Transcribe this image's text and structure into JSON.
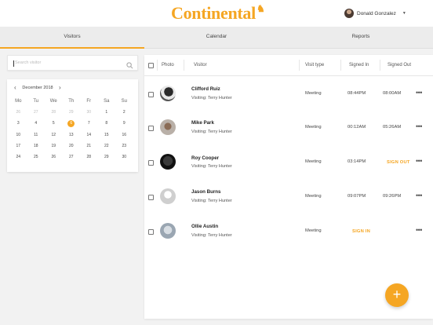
{
  "brand": {
    "logo_text": "Continental",
    "accent": "#f5a623"
  },
  "user": {
    "name": "Donald Gonzalez",
    "caret_icon": "chevron-down-icon"
  },
  "tabs": [
    {
      "label": "Visitors",
      "active": true
    },
    {
      "label": "Calendar",
      "active": false
    },
    {
      "label": "Reports",
      "active": false
    }
  ],
  "search": {
    "placeholder": "Search visitor",
    "icon": "search-icon"
  },
  "calendar": {
    "month_label": "December 2018",
    "prev_icon": "chevron-left-icon",
    "next_icon": "chevron-right-icon",
    "weekdays": [
      "Mo",
      "Tu",
      "We",
      "Th",
      "Fr",
      "Sa",
      "Su"
    ],
    "weeks": [
      [
        "26",
        "27",
        "28",
        "29",
        "30",
        "1",
        "2"
      ],
      [
        "3",
        "4",
        "5",
        "6",
        "7",
        "8",
        "9"
      ],
      [
        "10",
        "11",
        "12",
        "13",
        "14",
        "15",
        "16"
      ],
      [
        "17",
        "18",
        "19",
        "20",
        "21",
        "22",
        "23"
      ],
      [
        "24",
        "25",
        "26",
        "27",
        "28",
        "29",
        "30"
      ]
    ],
    "selected": "6"
  },
  "table": {
    "headers": {
      "photo": "Photo",
      "visitor": "Visitor",
      "visit_type": "Visit type",
      "signed_in": "Signed In",
      "signed_out": "Signed Out"
    },
    "rows": [
      {
        "name": "Clifford Ruiz",
        "visiting": "Visiting: Terry Hunter",
        "visit_type": "Meeting",
        "signed_in": "08:44PM",
        "signed_out": "08:00AM"
      },
      {
        "name": "Mike Park",
        "visiting": "Visiting: Terry Hunter",
        "visit_type": "Meeting",
        "signed_in": "00:12AM",
        "signed_out": "05:26AM"
      },
      {
        "name": "Roy Cooper",
        "visiting": "Visiting: Terry Hunter",
        "visit_type": "Meeting",
        "signed_in": "03:14PM",
        "signed_out": "SIGN OUT"
      },
      {
        "name": "Jason Burns",
        "visiting": "Visiting: Terry Hunter",
        "visit_type": "Meeting",
        "signed_in": "09:07PM",
        "signed_out": "09:26PM"
      },
      {
        "name": "Ollie Austin",
        "visiting": "Visiting: Terry Hunter",
        "visit_type": "Meeting",
        "signed_in": "SIGN IN",
        "signed_out": ""
      }
    ],
    "more_icon": "more-horizontal-icon"
  },
  "fab": {
    "label": "+",
    "icon": "plus-icon"
  }
}
